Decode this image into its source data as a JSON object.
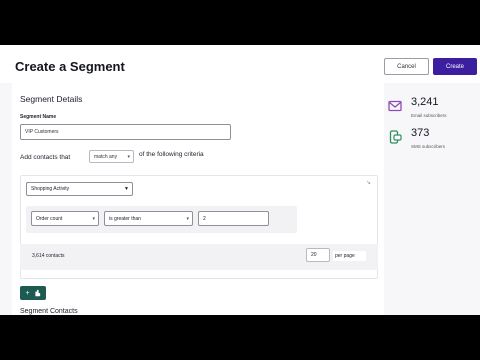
{
  "header": {
    "title": "Create a Segment",
    "cancel_label": "Cancel",
    "create_label": "Create"
  },
  "details": {
    "heading": "Segment Details",
    "name_label": "Segment Name",
    "name_value": "VIP Customers"
  },
  "criteria": {
    "prefix": "Add contacts that",
    "match_value": "match any",
    "suffix": "of the following criteria",
    "group": {
      "activity_value": "Shopping Activity",
      "rule": {
        "field_value": "Order count",
        "operator_value": "is greater than",
        "value": "2"
      }
    },
    "add_icon_glyph": "+"
  },
  "contacts": {
    "heading": "Segment Contacts",
    "count_text": "3,614 contacts",
    "per_page_value": "20",
    "per_page_label": "per page"
  },
  "stats": {
    "email": {
      "value": "3,241",
      "caption": "Email subscribers",
      "icon": "envelope-icon"
    },
    "sms": {
      "value": "373",
      "caption": "SMS subscribers",
      "icon": "sms-phone-icon"
    }
  },
  "colors": {
    "primary": "#3b1f9f",
    "add_button": "#1d5a52",
    "email_icon": "#8a4bb8",
    "sms_icon": "#2f8f62"
  }
}
